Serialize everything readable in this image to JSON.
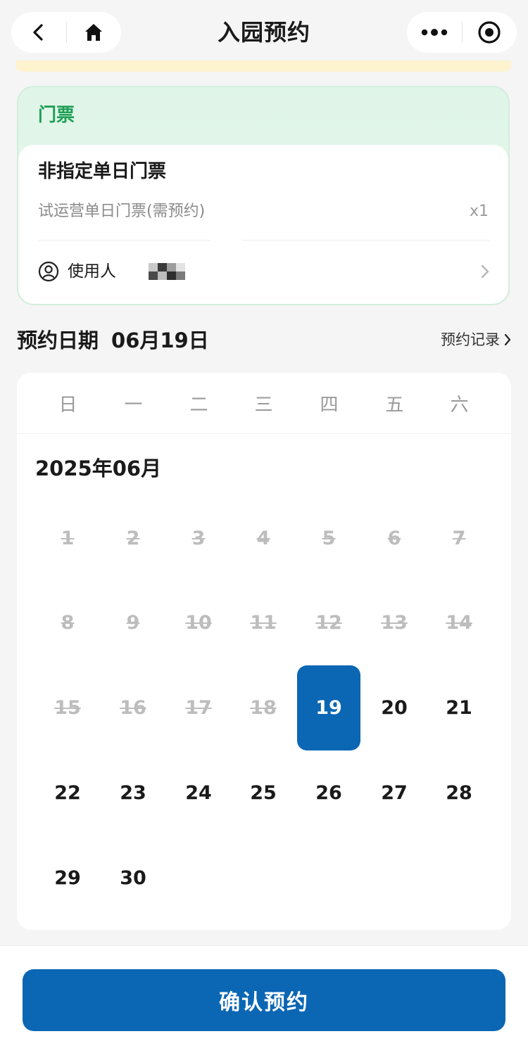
{
  "header": {
    "title": "入园预约",
    "icons": {
      "back": "back-arrow-icon",
      "home": "home-icon",
      "more": "more-dots-icon",
      "close": "target-close-icon"
    }
  },
  "ticket": {
    "tag": "门票",
    "name": "非指定单日门票",
    "description": "试运营单日门票(需预约)",
    "quantity": "x1",
    "user_label": "使用人",
    "user_icon": "user-circle-icon"
  },
  "booking": {
    "title": "预约日期",
    "selected_date": "06月19日",
    "record_link": "预约记录"
  },
  "calendar": {
    "weekdays": [
      "日",
      "一",
      "二",
      "三",
      "四",
      "五",
      "六"
    ],
    "month_title": "2025年06月",
    "days": [
      {
        "label": "1",
        "state": "disabled"
      },
      {
        "label": "2",
        "state": "disabled"
      },
      {
        "label": "3",
        "state": "disabled"
      },
      {
        "label": "4",
        "state": "disabled"
      },
      {
        "label": "5",
        "state": "disabled"
      },
      {
        "label": "6",
        "state": "disabled"
      },
      {
        "label": "7",
        "state": "disabled"
      },
      {
        "label": "8",
        "state": "disabled"
      },
      {
        "label": "9",
        "state": "disabled"
      },
      {
        "label": "10",
        "state": "disabled"
      },
      {
        "label": "11",
        "state": "disabled"
      },
      {
        "label": "12",
        "state": "disabled"
      },
      {
        "label": "13",
        "state": "disabled"
      },
      {
        "label": "14",
        "state": "disabled"
      },
      {
        "label": "15",
        "state": "disabled"
      },
      {
        "label": "16",
        "state": "disabled"
      },
      {
        "label": "17",
        "state": "disabled"
      },
      {
        "label": "18",
        "state": "disabled"
      },
      {
        "label": "19",
        "state": "selected"
      },
      {
        "label": "20",
        "state": "available"
      },
      {
        "label": "21",
        "state": "available"
      },
      {
        "label": "22",
        "state": "available"
      },
      {
        "label": "23",
        "state": "available"
      },
      {
        "label": "24",
        "state": "available"
      },
      {
        "label": "25",
        "state": "available"
      },
      {
        "label": "26",
        "state": "available"
      },
      {
        "label": "27",
        "state": "available"
      },
      {
        "label": "28",
        "state": "available"
      },
      {
        "label": "29",
        "state": "available"
      },
      {
        "label": "30",
        "state": "available"
      }
    ]
  },
  "confirm_button": {
    "label": "确认预约"
  },
  "colors": {
    "primary": "#0b66b3",
    "ticket_green": "#1e9e55",
    "ticket_bg": "#dff5e7",
    "notice_yellow": "#fdf3cf",
    "disabled_text": "#bdbdbd"
  }
}
